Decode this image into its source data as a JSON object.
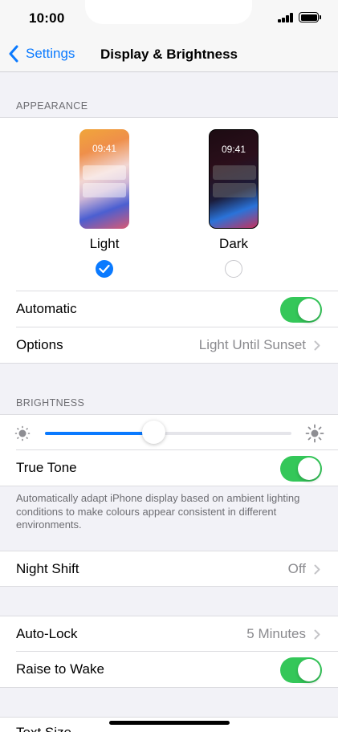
{
  "status_bar": {
    "time": "10:00"
  },
  "nav": {
    "back_label": "Settings",
    "title": "Display & Brightness"
  },
  "appearance": {
    "header": "APPEARANCE",
    "light": {
      "time": "09:41",
      "label": "Light",
      "selected": true
    },
    "dark": {
      "time": "09:41",
      "label": "Dark",
      "selected": false
    },
    "automatic": {
      "label": "Automatic",
      "on": true
    },
    "options": {
      "label": "Options",
      "value": "Light Until Sunset"
    }
  },
  "brightness": {
    "header": "BRIGHTNESS",
    "level": 0.44,
    "true_tone": {
      "label": "True Tone",
      "on": true
    },
    "footnote": "Automatically adapt iPhone display based on ambient lighting conditions to make colours appear consistent in different environments."
  },
  "night_shift": {
    "label": "Night Shift",
    "value": "Off"
  },
  "lock": {
    "auto_lock": {
      "label": "Auto-Lock",
      "value": "5 Minutes"
    },
    "raise_to_wake": {
      "label": "Raise to Wake",
      "on": true
    }
  },
  "partial_row": {
    "label": "Text Size"
  },
  "colors": {
    "accent": "#0a7aff",
    "toggle_on": "#34c759"
  }
}
